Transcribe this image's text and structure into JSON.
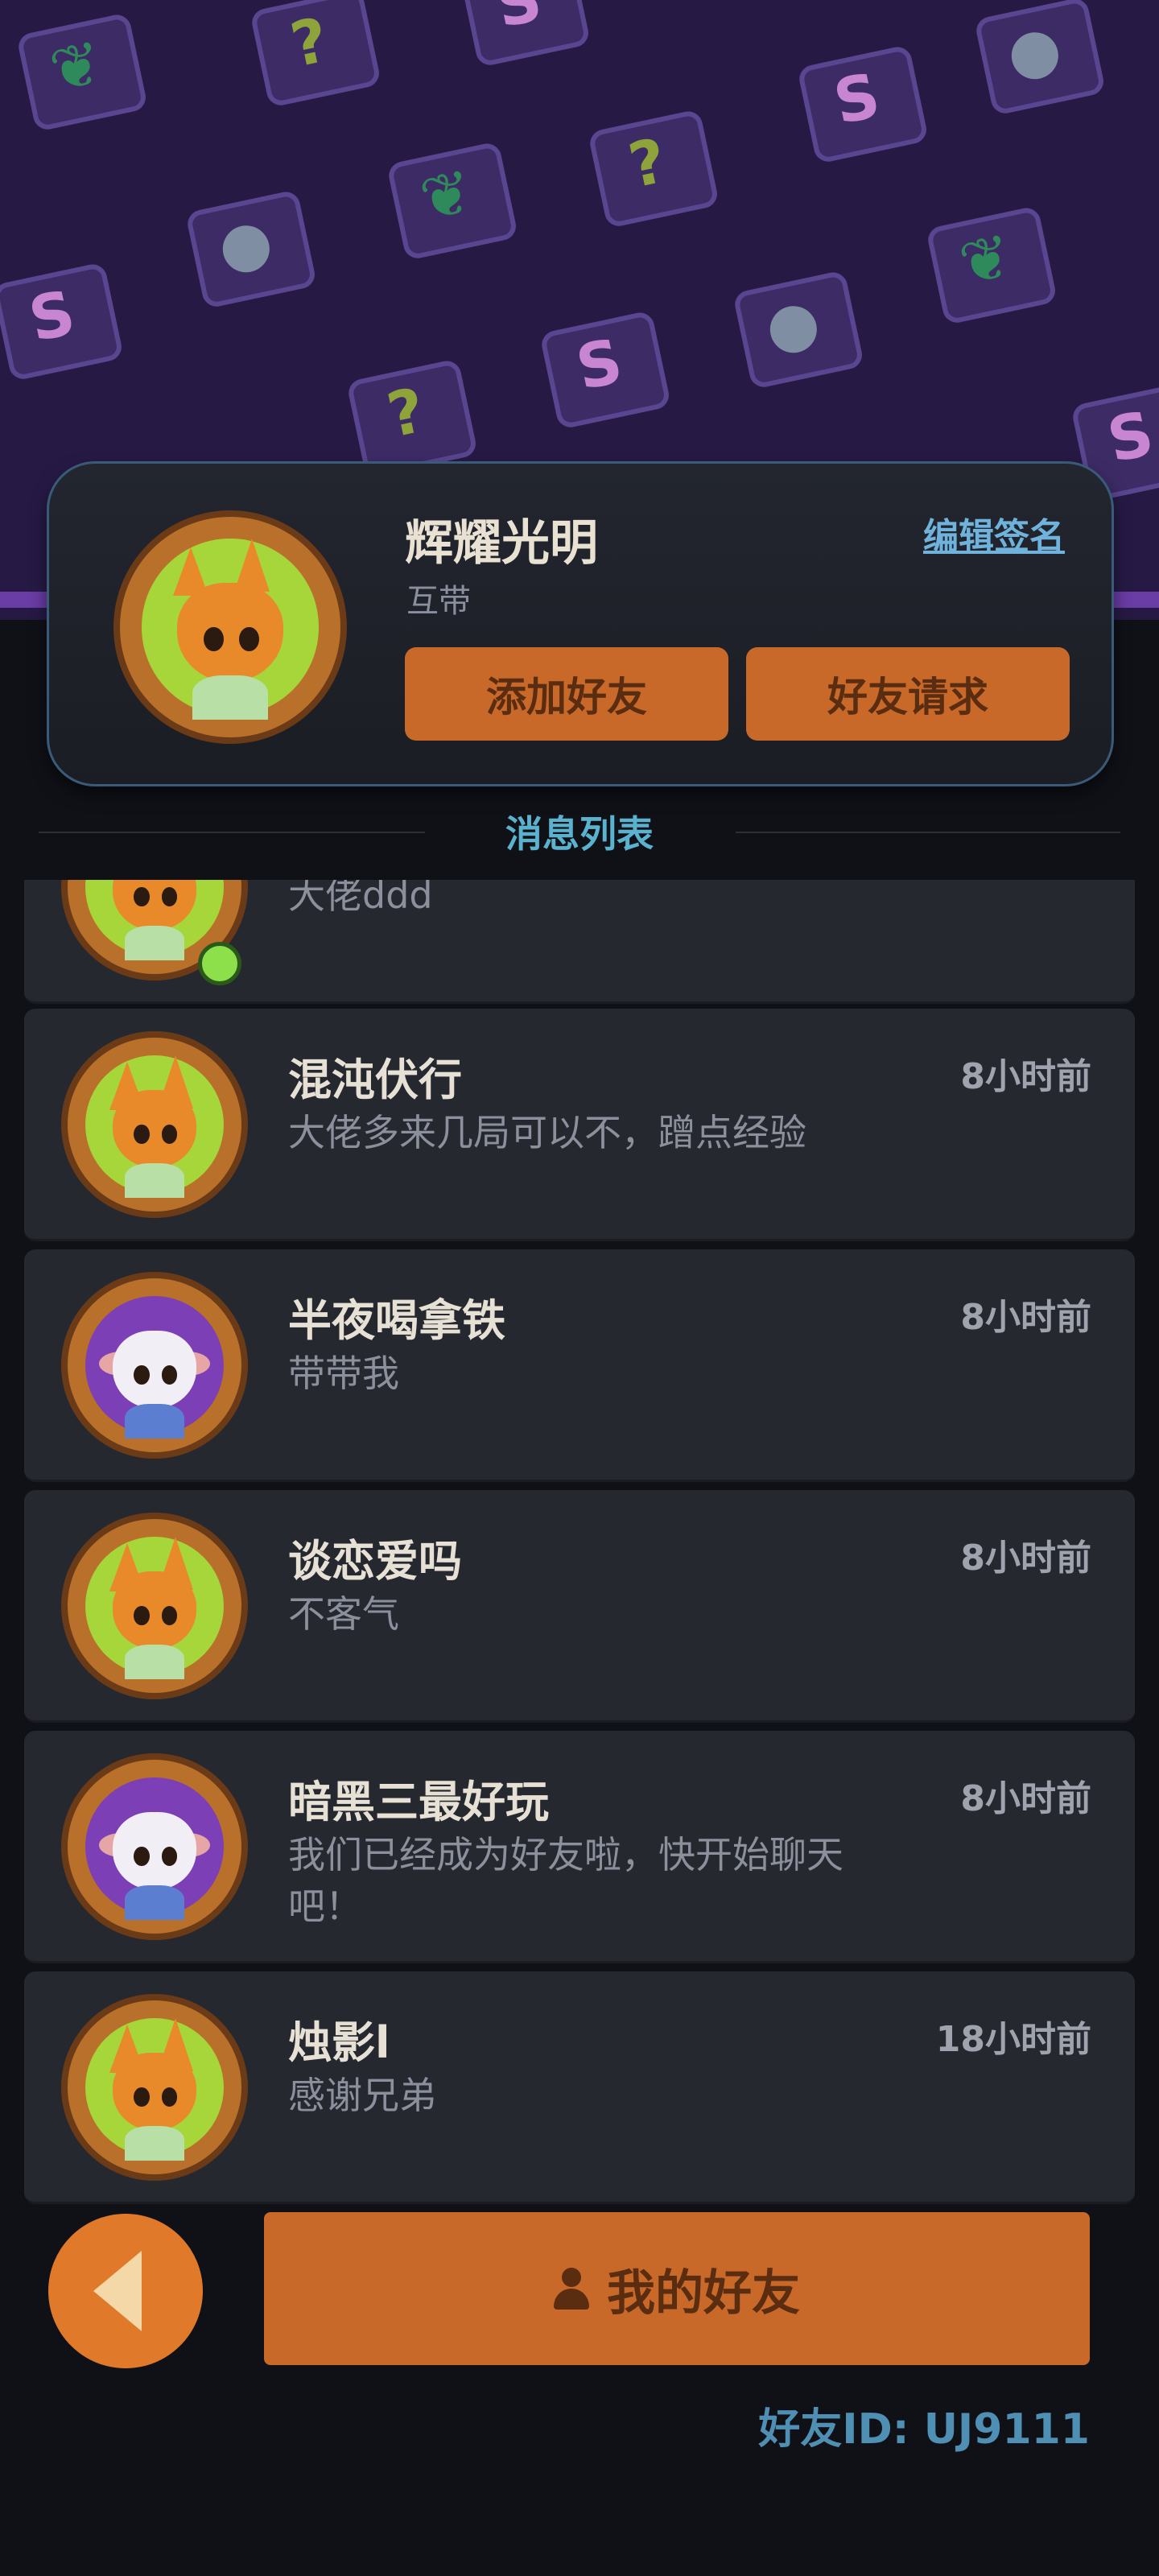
{
  "profile": {
    "name": "辉耀光明",
    "subtitle": "互带",
    "edit_sign_label": "编辑签名",
    "add_friend_label": "添加好友",
    "friend_request_label": "好友请求",
    "avatar_icon": "fox-avatar-icon"
  },
  "section": {
    "title": "消息列表"
  },
  "messages": [
    {
      "name": "",
      "preview": "大佬ddd",
      "time": "",
      "avatar": "fox",
      "online": true
    },
    {
      "name": "混沌伏行",
      "preview": "大佬多来几局可以不，蹭点经验",
      "time": "8小时前",
      "avatar": "fox"
    },
    {
      "name": "半夜喝拿铁",
      "preview": "带带我",
      "time": "8小时前",
      "avatar": "sheep"
    },
    {
      "name": "谈恋爱吗",
      "preview": "不客气",
      "time": "8小时前",
      "avatar": "fox"
    },
    {
      "name": "暗黑三最好玩",
      "preview": "我们已经成为好友啦，快开始聊天吧！",
      "time": "8小时前",
      "avatar": "sheep"
    },
    {
      "name": "烛影l",
      "preview": "感谢兄弟",
      "time": "18小时前",
      "avatar": "fox"
    }
  ],
  "footer": {
    "my_friends_label": "我的好友",
    "friend_id": "好友ID: UJ9111"
  },
  "colors": {
    "accent_orange": "#c8692a",
    "link_blue": "#6fb3dd",
    "online_green": "#8ee04a"
  }
}
